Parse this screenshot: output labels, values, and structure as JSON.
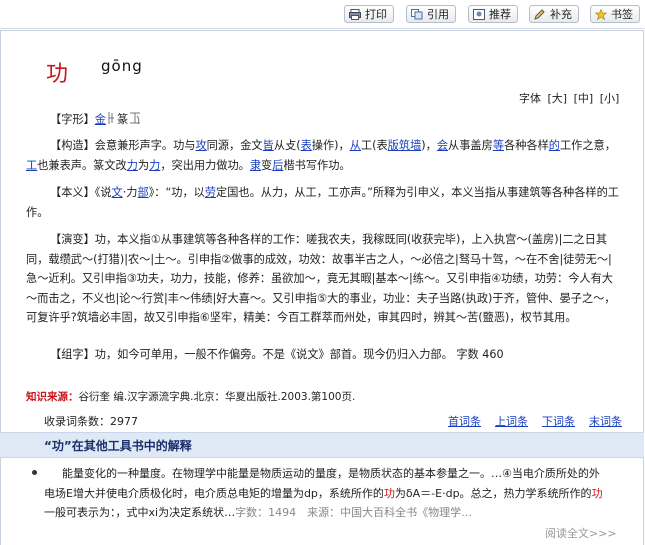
{
  "toolbar": {
    "print": "打印",
    "cite": "引用",
    "recommend": "推荐",
    "supplement": "补充",
    "bookmark": "书签"
  },
  "entry": {
    "char": "功",
    "pinyin": "gōng"
  },
  "font_size": {
    "label": "字体",
    "large": "[大]",
    "medium": "[中]",
    "small": "[小]"
  },
  "zixing": {
    "label": "【字形】",
    "link": "金",
    "rest": "篆"
  },
  "gouzao": {
    "label": "【构造】",
    "t1": "会意兼形声字。功与",
    "l1": "攻",
    "t2": "同源，金文",
    "l2": "皆",
    "t3": "从攴(",
    "l3": "表",
    "t4": "操作)，",
    "l4": "从",
    "t5": "工(表",
    "l5": "版",
    "l6": "筑",
    "l7": "墙",
    "t6": ")，",
    "l8": "会",
    "t7": "从事盖房",
    "l9": "等",
    "t8": "各种各样",
    "l10": "的",
    "t9": "工作之意，",
    "l11": "工",
    "t10": "也兼表声。篆文改",
    "l12": "力",
    "t11": "为",
    "l13": "力",
    "t12": "，突出用力做功。",
    "l14": "隶",
    "t13": "变",
    "l15": "后",
    "t14": "楷书写作功。"
  },
  "benyi": {
    "label": "【本义】",
    "t1": "《说",
    "l1": "文",
    "t2": "·力",
    "l2": "部",
    "t3": "》：“功，以",
    "l3": "劳",
    "t4": "定国也。从力，从工，工亦声。”所释为引申义，本义当指从事建筑等各种各样的工作。"
  },
  "yanbian": {
    "label": "【演变】",
    "text": "功，本义指①从事建筑等各种各样的工作：嗟我农夫，我稼既同(收获完毕)，上入执宫～(盖房)|二之日其同，载缵武～(打猎)|农～|土～。引申指②做事的成效，功效：故事半古之人，～必倍之|驽马十驾，～在不舍|徒劳无～|急～近利。又引申指③功夫，功力，技能，修养：虽欲加～，竟无其暇|基本～|练～。又引申指④功绩，功劳：今人有大～而击之，不义也|论～行赏|丰～伟绩|好大喜～。又引申指⑤大的事业，功业：夫子当路(执政)于齐，管仲、晏子之～，可复许乎?筑墙必丰固，故又引申指⑥坚牢，精美：今百工群萃而州处，审其四时，辨其～苦(盬恶)，权节其用。"
  },
  "zuzi": {
    "label": "【组字】",
    "text": "功，如今可单用，一般不作偏旁。不是《说文》部首。现今仍归入力部。 字数 460"
  },
  "source": {
    "label": "知识来源：",
    "text": "谷衍奎 编.汉字源流字典.北京：华夏出版社.2003.第100页."
  },
  "count": {
    "label": "收录词条数：",
    "value": "2977"
  },
  "pager": {
    "first": "首词条",
    "prev": "上词条",
    "next": "下词条",
    "last": "末词条"
  },
  "other_tools": {
    "title": "“功”在其他工具书中的解释"
  },
  "dict_entry": {
    "t1": "能量变化的一种量度。在物理学中能量是物质运动的量度，是物质状态的基本参量之一。…④当电介质所处的外电场E增大并使电介质极化时，电介质总电矩的增量为dp，系统所作的",
    "hl1": "功",
    "t2": "为δA＝-E·dp。总之，热力学系统所作的",
    "hl2": "功",
    "t3": "一般可表示为：，式中xi为决定系统状…",
    "meta": "字数：1494　来源：中国大百科全书《物理学…"
  },
  "more": "阅读全文>>>"
}
